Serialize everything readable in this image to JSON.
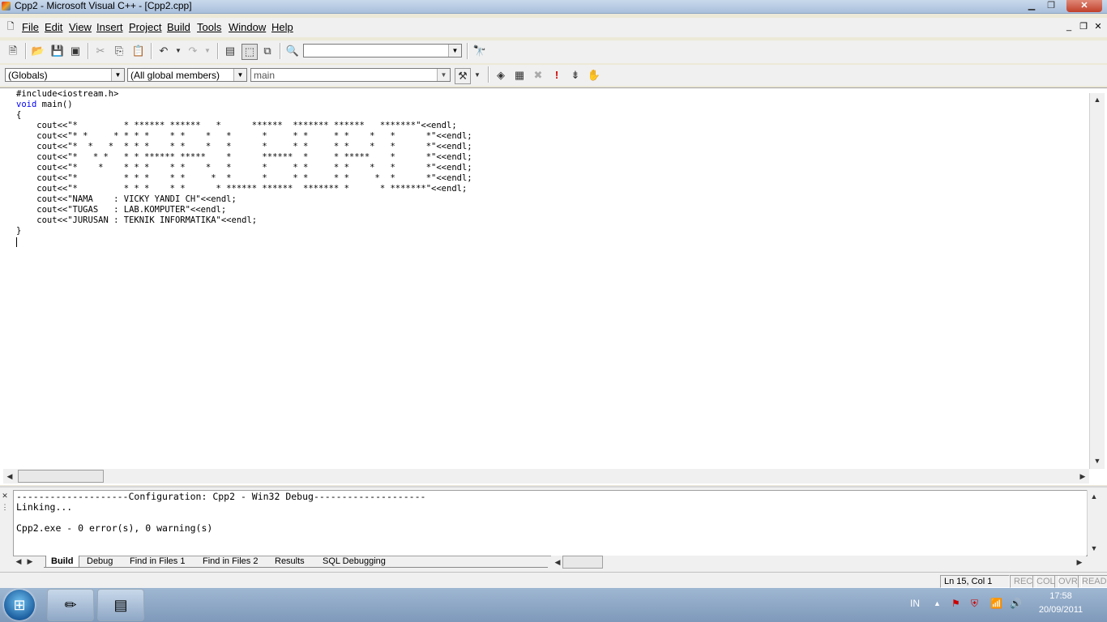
{
  "window": {
    "title": "Cpp2 - Microsoft Visual C++ - [Cpp2.cpp]"
  },
  "title_buttons": {
    "minimize": "▁",
    "maximize": "❐",
    "close": "✕"
  },
  "menu": [
    {
      "label": "File"
    },
    {
      "label": "Edit"
    },
    {
      "label": "View"
    },
    {
      "label": "Insert"
    },
    {
      "label": "Project"
    },
    {
      "label": "Build"
    },
    {
      "label": "Tools"
    },
    {
      "label": "Window"
    },
    {
      "label": "Help"
    }
  ],
  "toolbar": {
    "find_combo_value": "",
    "icons": [
      "new-text-file-icon",
      "open-folder-icon",
      "save-icon",
      "save-all-icon",
      "cut-icon",
      "copy-icon",
      "paste-icon",
      "undo-icon",
      "redo-icon",
      "workspace-icon",
      "output-window-icon",
      "window-list-icon",
      "find-in-files-icon",
      "find-icon"
    ]
  },
  "wizardbar": {
    "class_combo": "(Globals)",
    "members_combo": "(All global members)",
    "function_combo": "main",
    "icons": [
      "compile-icon",
      "build-icon",
      "stop-build-icon",
      "execute-icon",
      "go-icon",
      "breakpoint-icon"
    ]
  },
  "editor": {
    "code": [
      {
        "pre": "",
        "kw": "",
        "text": "#include<iostream.h>"
      },
      {
        "pre": "",
        "kw": "void",
        "text": " main()"
      },
      {
        "pre": "",
        "kw": "",
        "text": "{"
      },
      {
        "pre": "",
        "kw": "",
        "text": "    cout<<\"*         * ****** ******   *      ******  ******* ******   *******\"<<endl;"
      },
      {
        "pre": "",
        "kw": "",
        "text": "    cout<<\"* *     * * * *    * *    *   *      *     * *     * *    *   *      *\"<<endl;"
      },
      {
        "pre": "",
        "kw": "",
        "text": "    cout<<\"*  *   *  * * *    * *    *   *      *     * *     * *    *   *      *\"<<endl;"
      },
      {
        "pre": "",
        "kw": "",
        "text": "    cout<<\"*   * *   * * ****** *****    *      ******  *     * *****    *      *\"<<endl;"
      },
      {
        "pre": "",
        "kw": "",
        "text": "    cout<<\"*    *    * * *    * *    *   *      *     * *     * *    *   *      *\"<<endl;"
      },
      {
        "pre": "",
        "kw": "",
        "text": "    cout<<\"*         * * *    * *     *  *      *     * *     * *     *  *      *\"<<endl;"
      },
      {
        "pre": "",
        "kw": "",
        "text": "    cout<<\"*         * * *    * *      * ****** ******  ******* *      * *******\"<<endl;"
      },
      {
        "pre": "",
        "kw": "",
        "text": "    cout<<\"NAMA    : VICKY YANDI CH\"<<endl;"
      },
      {
        "pre": "",
        "kw": "",
        "text": "    cout<<\"TUGAS   : LAB.KOMPUTER\"<<endl;"
      },
      {
        "pre": "",
        "kw": "",
        "text": "    cout<<\"JURUSAN : TEKNIK INFORMATIKA\"<<endl;"
      },
      {
        "pre": "",
        "kw": "",
        "text": "}"
      }
    ]
  },
  "output": {
    "lines": [
      "--------------------Configuration: Cpp2 - Win32 Debug--------------------",
      "Linking...",
      "",
      "Cpp2.exe - 0 error(s), 0 warning(s)"
    ],
    "tabs": [
      "Build",
      "Debug",
      "Find in Files 1",
      "Find in Files 2",
      "Results",
      "SQL Debugging"
    ],
    "active_tab": "Build"
  },
  "status": {
    "position": "Ln 15, Col 1",
    "rec": "REC",
    "col": "COL",
    "ovr": "OVR",
    "read": "READ"
  },
  "taskbar": {
    "language": "IN",
    "time": "17:58",
    "date": "20/09/2011"
  }
}
